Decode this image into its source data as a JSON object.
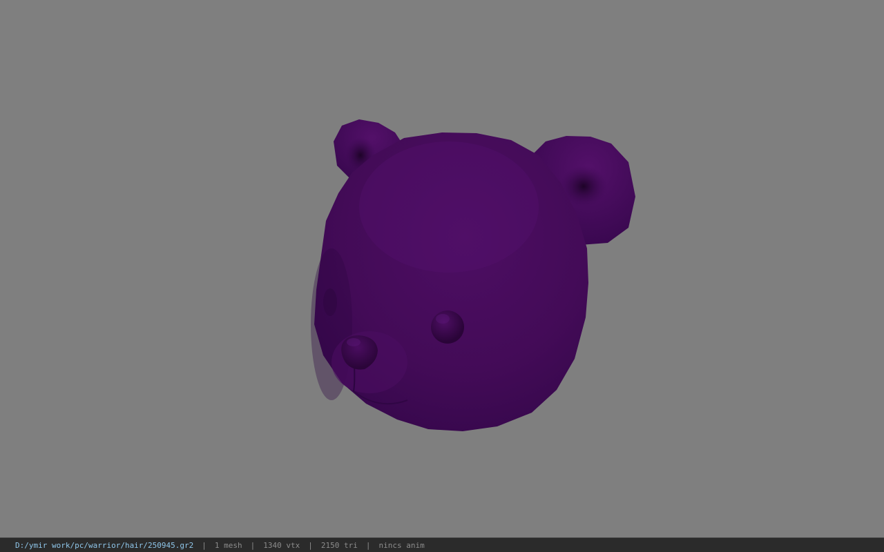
{
  "viewport": {
    "background_color": "#7f7f7f",
    "model": {
      "subject": "teddy bear head mesh",
      "base_color": "#4a0f5e",
      "highlight_color": "#5e1a78",
      "shadow_color": "#2a0536"
    }
  },
  "statusbar": {
    "file_path": "D:/ymir work/pc/warrior/hair/250945.gr2",
    "separator": "|",
    "mesh_count": "1 mesh",
    "vertex_count": "1340 vtx",
    "triangle_count": "2150 tri",
    "anim_status": "nincs anim"
  }
}
